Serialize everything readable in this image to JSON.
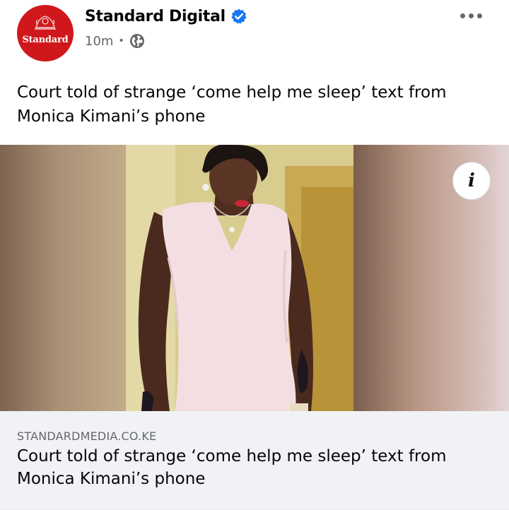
{
  "post": {
    "page_name": "Standard Digital",
    "avatar_brand": "Standard",
    "verified_icon": "verified-badge-icon",
    "time": "10m",
    "separator": "•",
    "audience_icon": "globe-icon",
    "more_icon": "more-options-icon",
    "text": "Court told of strange ‘come help me sleep’ text from Monica Kimani’s phone"
  },
  "media": {
    "info_label": "i"
  },
  "link_preview": {
    "domain": "STANDARDMEDIA.CO.KE",
    "title": "Court told of strange ‘come help me sleep’ text from Monica Kimani’s phone"
  },
  "colors": {
    "brand_red": "#d0181c",
    "verified_blue": "#1877f2",
    "secondary_text": "#65676b",
    "card_background": "#f0f2f5"
  }
}
